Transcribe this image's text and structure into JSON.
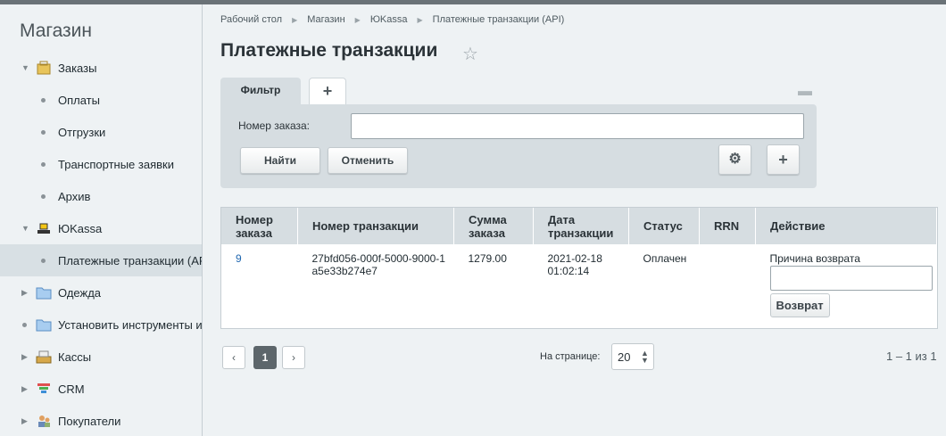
{
  "sidebar": {
    "title": "Магазин",
    "items": [
      {
        "label": "Заказы",
        "icon": "bag-icon",
        "expanded": true
      },
      {
        "label": "Оплаты"
      },
      {
        "label": "Отгрузки"
      },
      {
        "label": "Транспортные заявки"
      },
      {
        "label": "Архив"
      },
      {
        "label": "ЮKassa",
        "icon": "kassa-icon",
        "expanded": true
      },
      {
        "label": "Платежные транзакции (API)",
        "active": true
      },
      {
        "label": "Одежда",
        "icon": "folder-icon"
      },
      {
        "label": "Установить инструменты и",
        "icon": "folder-icon"
      },
      {
        "label": "Кассы",
        "icon": "cash-register-icon"
      },
      {
        "label": "CRM",
        "icon": "funnel-icon"
      },
      {
        "label": "Покупатели",
        "icon": "users-icon"
      }
    ]
  },
  "breadcrumbs": [
    "Рабочий стол",
    "Магазин",
    "ЮKassa",
    "Платежные транзакции (API)"
  ],
  "page_title": "Платежные транзакции",
  "filter": {
    "tab_label": "Фильтр",
    "field_label": "Номер заказа:",
    "field_value": "",
    "find_label": "Найти",
    "cancel_label": "Отменить"
  },
  "table": {
    "headers": [
      "Номер заказа",
      "Номер транзакции",
      "Сумма заказа",
      "Дата транзакции",
      "Статус",
      "RRN",
      "Действие"
    ],
    "rows": [
      {
        "order": "9",
        "transaction": "27bfd056-000f-5000-9000-1a5e33b274e7",
        "amount": "1279.00",
        "date": "2021-02-18 01:02:14",
        "status": "Оплачен",
        "rrn": "",
        "action_label": "Причина возврата",
        "action_button": "Возврат"
      }
    ]
  },
  "pager": {
    "current_page": "1",
    "per_page_label": "На странице:",
    "per_page": "20",
    "count": "1 – 1 из 1"
  }
}
